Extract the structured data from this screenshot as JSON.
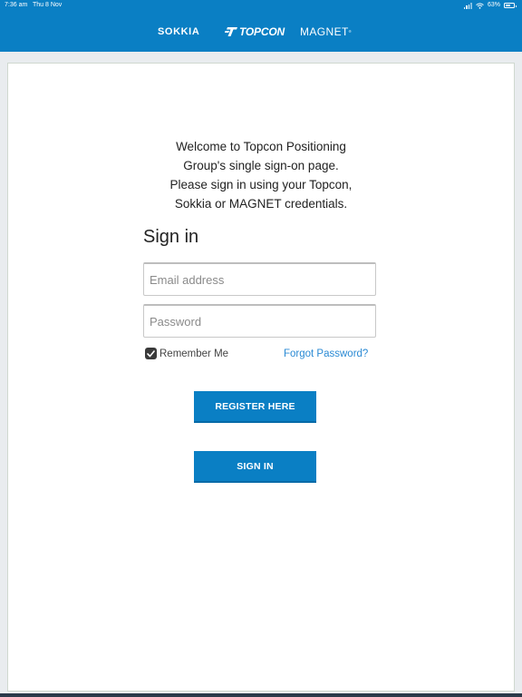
{
  "status_bar": {
    "time": "7:36 am",
    "date": "Thu 8 Nov",
    "battery": "63%",
    "battery_level": 0.63
  },
  "brands": {
    "sokkia": "SOKKIA",
    "topcon": "TOPCON",
    "magnet": "MAGNET"
  },
  "welcome": {
    "line1": "Welcome to Topcon Positioning",
    "line2": "Group's single sign-on page.",
    "line3": "Please sign in using your Topcon,",
    "line4": "Sokkia or MAGNET credentials."
  },
  "form": {
    "title": "Sign in",
    "email_placeholder": "Email address",
    "email_value": "",
    "password_placeholder": "Password",
    "password_value": "",
    "remember_label": "Remember Me",
    "remember_checked": true,
    "forgot_label": "Forgot Password?",
    "register_label": "REGISTER HERE",
    "signin_label": "SIGN IN"
  },
  "colors": {
    "brand_blue": "#0a7fc4",
    "link_blue": "#2a8ad4"
  }
}
